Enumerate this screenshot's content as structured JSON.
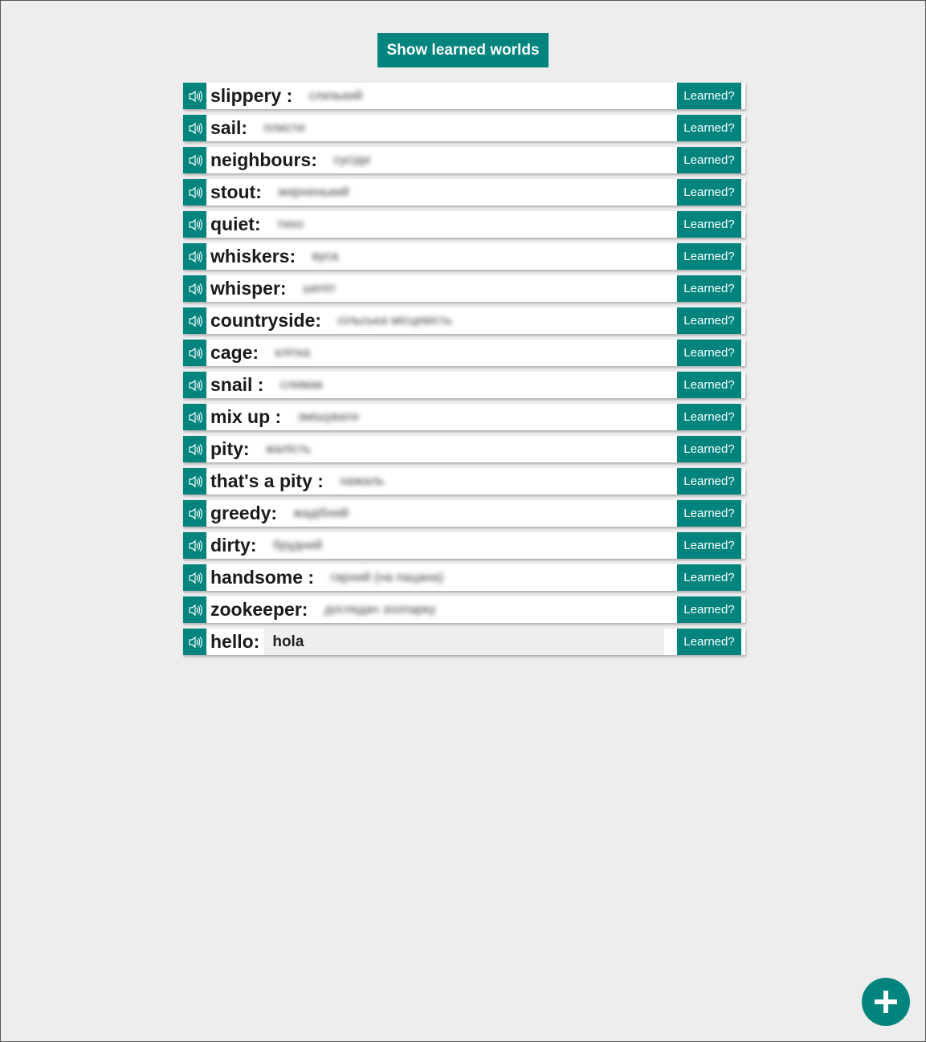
{
  "header": {
    "show_learned_label": "Show learned worlds"
  },
  "words": [
    {
      "word": "slippery : ",
      "translation": "слизький"
    },
    {
      "word": "sail: ",
      "translation": "плисти"
    },
    {
      "word": "neighbours: ",
      "translation": "сусіди"
    },
    {
      "word": "stout: ",
      "translation": "жирненький"
    },
    {
      "word": "quiet: ",
      "translation": "тихо"
    },
    {
      "word": "whiskers: ",
      "translation": "вуса"
    },
    {
      "word": "whisper: ",
      "translation": "шепіт"
    },
    {
      "word": "countryside: ",
      "translation": "сільська місцевість"
    },
    {
      "word": "cage: ",
      "translation": "клітка"
    },
    {
      "word": "snail : ",
      "translation": "слимак"
    },
    {
      "word": "mix up : ",
      "translation": "змішувати"
    },
    {
      "word": "pity: ",
      "translation": "жалість"
    },
    {
      "word": "that's a pity : ",
      "translation": "нажаль"
    },
    {
      "word": "greedy: ",
      "translation": "жадібний"
    },
    {
      "word": "dirty: ",
      "translation": "брудний"
    },
    {
      "word": "handsome : ",
      "translation": "гарний (на пацана)"
    },
    {
      "word": "zookeeper: ",
      "translation": "доглядач зоопарку"
    }
  ],
  "new_entry": {
    "word": "hello:",
    "translation_value": "hola"
  },
  "learned_label": "Learned?",
  "icons": {
    "speaker": "speaker-icon",
    "add": "plus-icon"
  },
  "colors": {
    "accent": "#00847d",
    "background": "#ededed"
  }
}
